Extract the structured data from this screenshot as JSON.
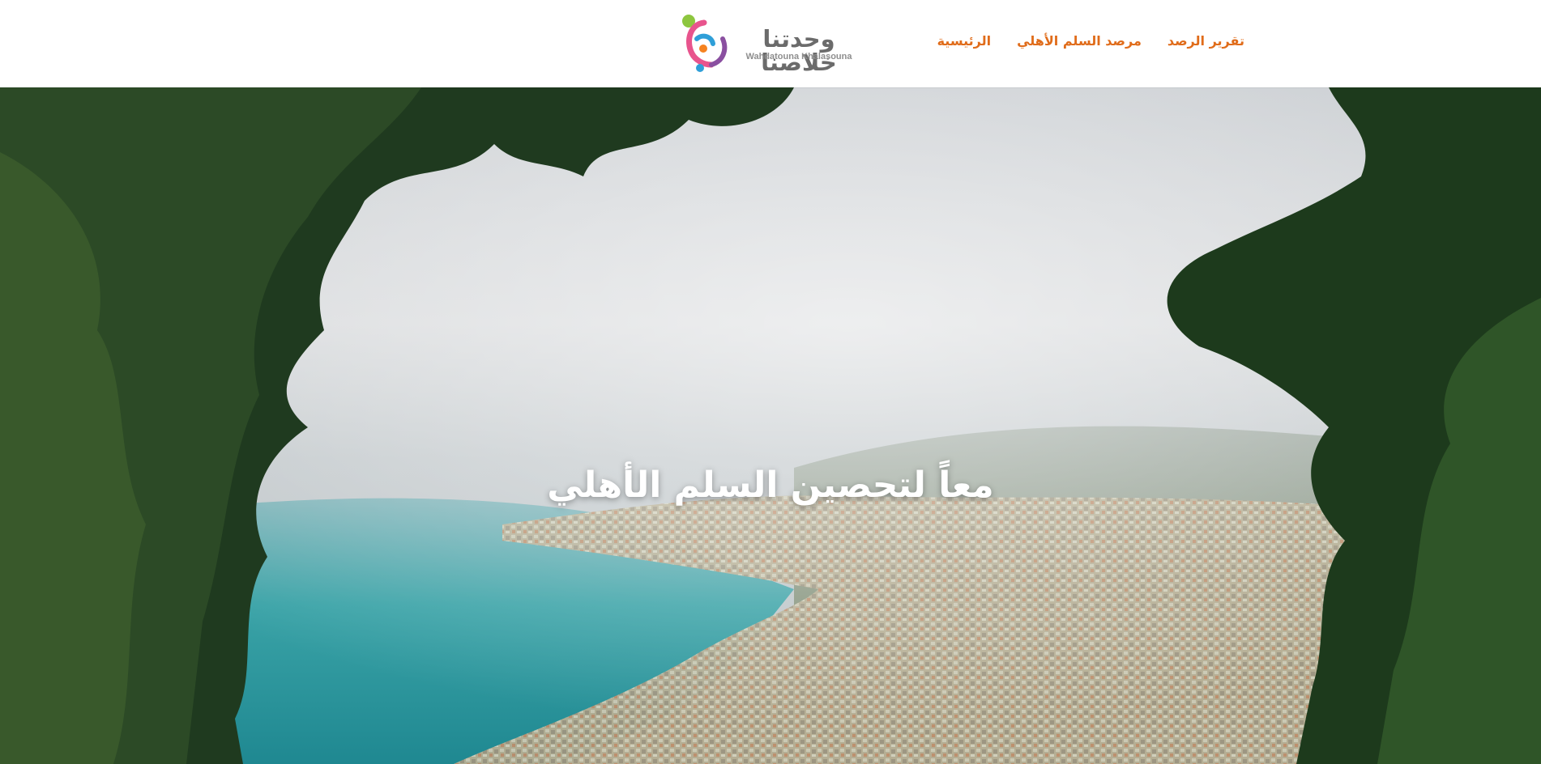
{
  "brand": {
    "name_ar": "وحدتنا خلاصنا",
    "name_en": "Wahdatouna Khalasouna",
    "logo_colors": [
      "#8dc63f",
      "#e8548d",
      "#2f9fd8",
      "#f58220",
      "#8a4fa0"
    ]
  },
  "nav": {
    "items": [
      {
        "label": "الرئيسية"
      },
      {
        "label": "مرصد السلم الأهلي"
      },
      {
        "label": "تقرير الرصد"
      }
    ],
    "color": "#e06c1a"
  },
  "hero": {
    "title": "معاً لتحصين السلم الأهلي",
    "image": "aerial-coastal-city-framed-by-trees"
  }
}
